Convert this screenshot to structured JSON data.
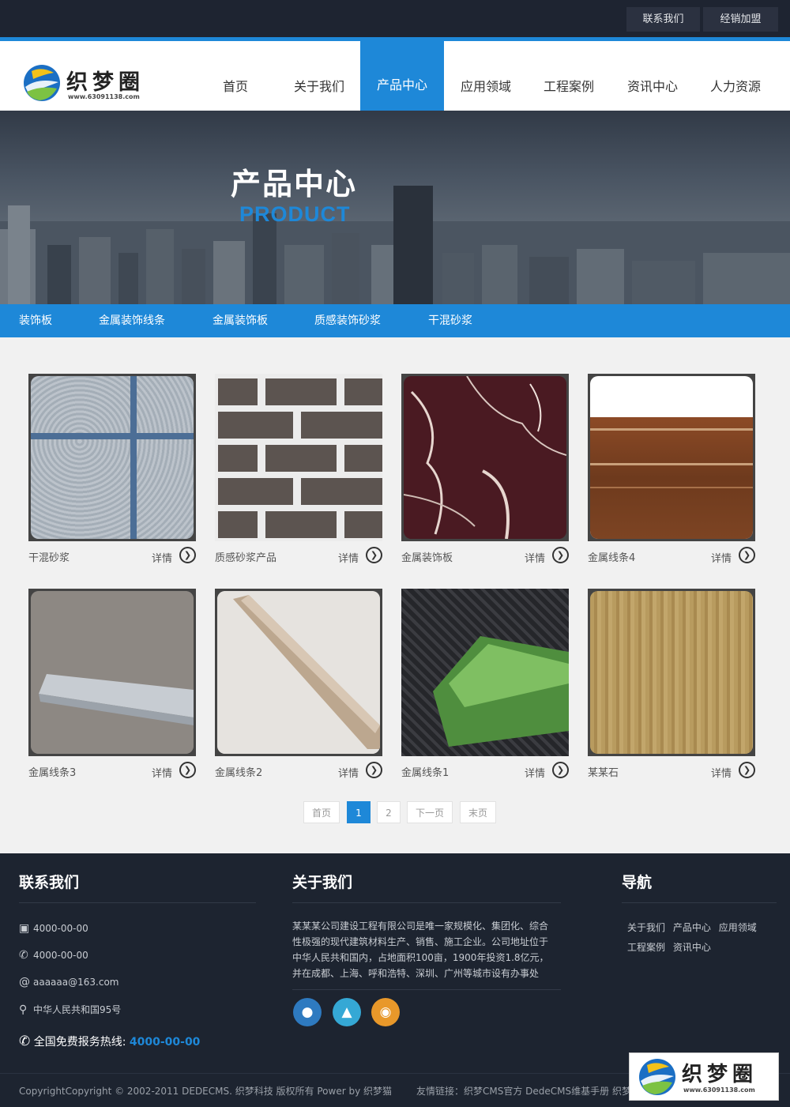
{
  "topbar": {
    "contact": "联系我们",
    "dealer": "经销加盟"
  },
  "logo": {
    "text": "织梦圈",
    "url": "www.63091138.com"
  },
  "nav": [
    {
      "label": "首页"
    },
    {
      "label": "关于我们"
    },
    {
      "label": "产品中心"
    },
    {
      "label": "应用领域"
    },
    {
      "label": "工程案例"
    },
    {
      "label": "资讯中心"
    },
    {
      "label": "人力资源"
    }
  ],
  "nav_active": "产品中心",
  "banner": {
    "title": "产品中心",
    "subtitle": "PRODUCT"
  },
  "categories": [
    "装饰板",
    "金属装饰线条",
    "金属装饰板",
    "质感装饰砂浆",
    "干混砂浆"
  ],
  "products": [
    {
      "name": "干混砂浆",
      "detail": "详情"
    },
    {
      "name": "质感砂浆产品",
      "detail": "详情"
    },
    {
      "name": "金属装饰板",
      "detail": "详情"
    },
    {
      "name": "金属线条4",
      "detail": "详情"
    },
    {
      "name": "金属线条3",
      "detail": "详情"
    },
    {
      "name": "金属线条2",
      "detail": "详情"
    },
    {
      "name": "金属线条1",
      "detail": "详情"
    },
    {
      "name": "某某石",
      "detail": "详情"
    }
  ],
  "pagination": {
    "first": "首页",
    "p1": "1",
    "p2": "2",
    "next": "下一页",
    "last": "末页",
    "current": 1
  },
  "footer": {
    "contact_title": "联系我们",
    "about_title": "关于我们",
    "nav_title": "导航",
    "fax": "4000-00-00",
    "phone": "4000-00-00",
    "email": "aaaaaa@163.com",
    "address": "中华人民共和国95号",
    "hotline_label": "全国免费报务热线:",
    "hotline_number": "4000-00-00",
    "about_text": "某某某公司建设工程有限公司是唯一家规模化、集团化、综合性极强的现代建筑材料生产、销售、施工企业。公司地址位于中华人民共和国内，占地面积100亩，1900年投资1.8亿元，并在成都、上海、呼和浩特、深圳、广州等城市设有办事处",
    "nav_links": [
      "关于我们",
      "产品中心",
      "应用领域",
      "工程案例",
      "资讯中心"
    ],
    "copyright": "CopyrightCopyright © 2002-2011 DEDECMS. 织梦科技 版权所有 Power by 织梦猫",
    "friend_links": "友情链接：织梦CMS官方 DedeCMS维基手册 织梦猫"
  },
  "colors": {
    "brand": "#1e88d8",
    "topbar": "#1e2431",
    "footer": "#1d2430",
    "wechat": "#2e7ac0",
    "qq": "#35a8d5",
    "weibo": "#e8982a"
  },
  "icons": {
    "fax": "fax-icon",
    "phone": "phone-icon",
    "email": "at-icon",
    "address": "location-pin-icon",
    "hotline": "phone-call-icon",
    "arrow": "chevron-right-circle-icon"
  }
}
